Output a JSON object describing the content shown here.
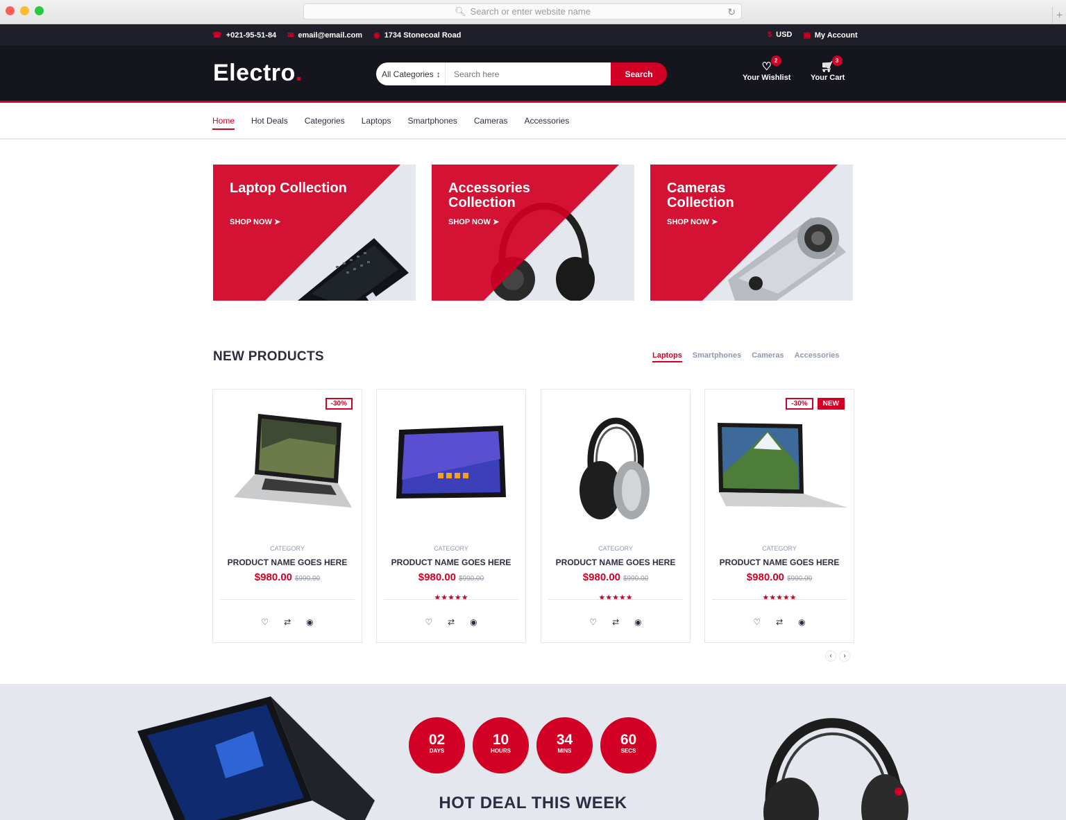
{
  "browser": {
    "url_placeholder": "Search or enter website name"
  },
  "topbar": {
    "phone": "+021-95-51-84",
    "email": "email@email.com",
    "address": "1734 Stonecoal Road",
    "currency": "USD",
    "account": "My Account"
  },
  "header": {
    "logo": "Electro",
    "logo_dot": ".",
    "category_select": "All Categories",
    "search_placeholder": "Search here",
    "search_button": "Search",
    "wishlist_label": "Your Wishlist",
    "wishlist_qty": "2",
    "cart_label": "Your Cart",
    "cart_qty": "3"
  },
  "nav": {
    "items": [
      "Home",
      "Hot Deals",
      "Categories",
      "Laptops",
      "Smartphones",
      "Cameras",
      "Accessories"
    ]
  },
  "collections": [
    {
      "title": "Laptop Collection",
      "cta": "SHOP NOW"
    },
    {
      "title": "Accessories Collection",
      "cta": "SHOP NOW"
    },
    {
      "title": "Cameras Collection",
      "cta": "SHOP NOW"
    }
  ],
  "new_products": {
    "title": "NEW PRODUCTS",
    "tabs": [
      "Laptops",
      "Smartphones",
      "Cameras",
      "Accessories"
    ],
    "products": [
      {
        "category": "CATEGORY",
        "name": "PRODUCT NAME GOES HERE",
        "price": "$980.00",
        "old_price": "$990.00",
        "sale": "-30%",
        "new": "",
        "stars": "",
        "rating": 0
      },
      {
        "category": "CATEGORY",
        "name": "PRODUCT NAME GOES HERE",
        "price": "$980.00",
        "old_price": "$990.00",
        "sale": "",
        "new": "",
        "stars": "★★★★★",
        "rating": 5
      },
      {
        "category": "CATEGORY",
        "name": "PRODUCT NAME GOES HERE",
        "price": "$980.00",
        "old_price": "$990.00",
        "sale": "",
        "new": "",
        "stars": "★★★★★",
        "rating": 5
      },
      {
        "category": "CATEGORY",
        "name": "PRODUCT NAME GOES HERE",
        "price": "$980.00",
        "old_price": "$990.00",
        "sale": "-30%",
        "new": "NEW",
        "stars": "★★★★★",
        "rating": 5
      }
    ]
  },
  "hot_deal": {
    "countdown": [
      {
        "value": "02",
        "unit": "Days"
      },
      {
        "value": "10",
        "unit": "Hours"
      },
      {
        "value": "34",
        "unit": "Mins"
      },
      {
        "value": "60",
        "unit": "Secs"
      }
    ],
    "title": "HOT DEAL THIS WEEK"
  },
  "colors": {
    "accent": "#d10024",
    "dark": "#15161d",
    "topbar": "#1e1f29",
    "light_bg": "#e4e7ed",
    "text": "#2b2d42",
    "muted": "#8d99ae"
  }
}
